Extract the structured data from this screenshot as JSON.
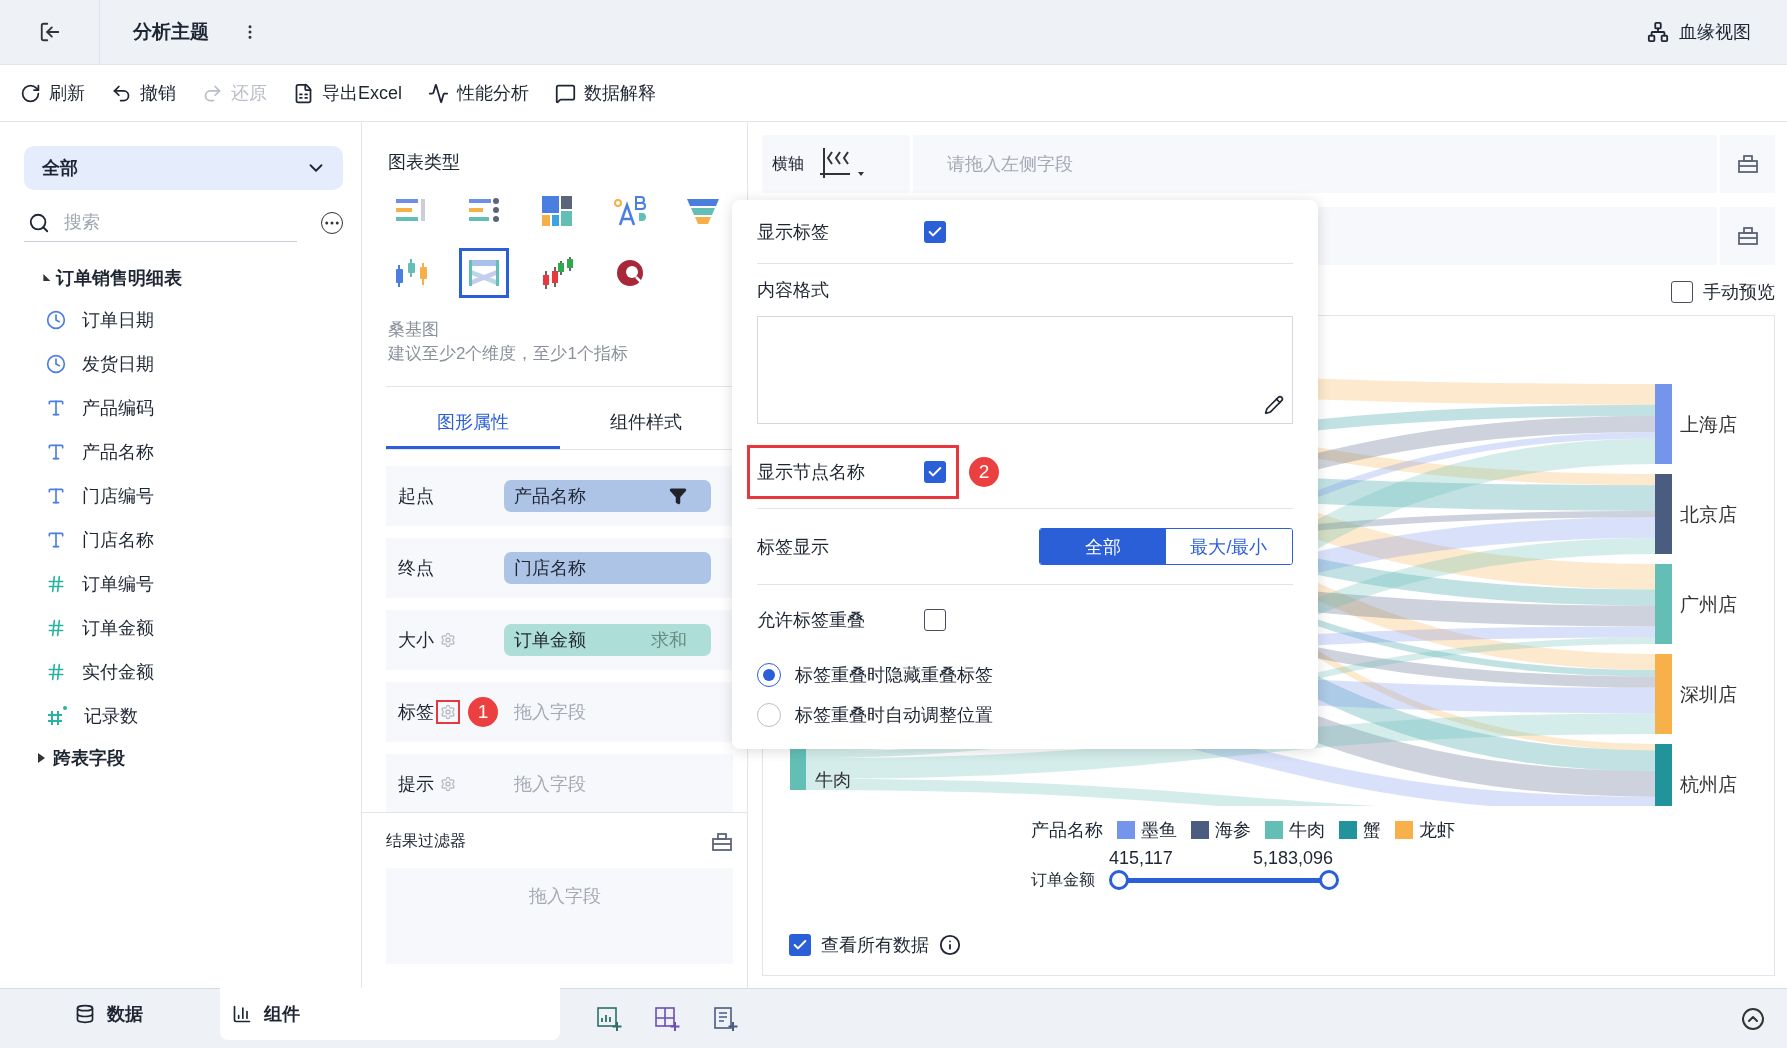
{
  "header": {
    "title": "分析主题",
    "lineage_button": "血缘视图"
  },
  "toolbar": [
    {
      "label": "刷新",
      "kind": "refresh",
      "disabled": false
    },
    {
      "label": "撤销",
      "kind": "undo",
      "disabled": false
    },
    {
      "label": "还原",
      "kind": "redo",
      "disabled": true
    },
    {
      "label": "导出Excel",
      "kind": "excel",
      "disabled": false
    },
    {
      "label": "性能分析",
      "kind": "performance",
      "disabled": false
    },
    {
      "label": "数据解释",
      "kind": "explain",
      "disabled": false
    }
  ],
  "field_panel": {
    "dataset_selector": "全部",
    "search": {
      "placeholder": "搜索"
    },
    "tree": [
      {
        "label": "订单销售明细表",
        "expanded": true,
        "children": [
          {
            "label": "订单日期",
            "kind": "date"
          },
          {
            "label": "发货日期",
            "kind": "date"
          },
          {
            "label": "产品编码",
            "kind": "text"
          },
          {
            "label": "产品名称",
            "kind": "text"
          },
          {
            "label": "门店编号",
            "kind": "text"
          },
          {
            "label": "门店名称",
            "kind": "text"
          },
          {
            "label": "订单编号",
            "kind": "number"
          },
          {
            "label": "订单金额",
            "kind": "number"
          },
          {
            "label": "实付金额",
            "kind": "number"
          },
          {
            "label": "记录数",
            "kind": "count"
          }
        ]
      },
      {
        "label": "跨表字段",
        "expanded": false
      }
    ]
  },
  "chart_types": {
    "title": "图表类型",
    "types": [
      {
        "kind": "ranked-list",
        "selected": false
      },
      {
        "kind": "dot-list",
        "selected": false
      },
      {
        "kind": "treemap",
        "selected": false
      },
      {
        "kind": "word-cloud",
        "selected": false
      },
      {
        "kind": "funnel",
        "selected": false
      },
      {
        "kind": "boxplot",
        "selected": false
      },
      {
        "kind": "sankey",
        "selected": true
      },
      {
        "kind": "candlestick",
        "selected": false
      },
      {
        "kind": "ring",
        "selected": false
      }
    ],
    "name": "桑基图",
    "hint": "建议至少2个维度，至少1个指标"
  },
  "property_tabs": [
    {
      "label": "图形属性",
      "selected": true
    },
    {
      "label": "组件样式",
      "selected": false
    }
  ],
  "slots": [
    {
      "label": "起点",
      "kind": "dimension",
      "field": "产品名称",
      "filter": true,
      "settings": false
    },
    {
      "label": "终点",
      "kind": "dimension",
      "field": "门店名称",
      "settings": false
    },
    {
      "label": "大小",
      "kind": "measure",
      "field": "订单金额",
      "aggregation": "求和",
      "settings": true
    },
    {
      "label": "标签",
      "kind": "empty",
      "hint": "拖入字段",
      "settings": true,
      "highlighted": true,
      "step": "1"
    },
    {
      "label": "提示",
      "kind": "empty",
      "hint": "拖入字段",
      "settings": true
    }
  ],
  "result_filter": {
    "title": "结果过滤器",
    "hint": "拖入字段"
  },
  "axis": {
    "label": "横轴",
    "hint": "请拖入左侧字段"
  },
  "manual_preview": {
    "label": "手动预览",
    "checked": false
  },
  "label_popup": {
    "show_label": {
      "label": "显示标签",
      "checked": true
    },
    "content_format": {
      "label": "内容格式"
    },
    "show_node_name": {
      "label": "显示节点名称",
      "checked": true,
      "highlighted": true,
      "step": "2"
    },
    "label_display": {
      "label": "标签显示",
      "options": [
        {
          "label": "全部",
          "selected": true
        },
        {
          "label": "最大/最小",
          "selected": false
        }
      ]
    },
    "allow_overlap": {
      "label": "允许标签重叠",
      "checked": false
    },
    "overlap_modes": [
      {
        "label": "标签重叠时隐藏重叠标签",
        "selected": true
      },
      {
        "label": "标签重叠时自动调整位置",
        "selected": false
      }
    ]
  },
  "chart": {
    "target_nodes": [
      {
        "label": "上海店",
        "color": "#7594ec"
      },
      {
        "label": "北京店",
        "color": "#4a5c80"
      },
      {
        "label": "广州店",
        "color": "#63bfb5"
      },
      {
        "label": "深圳店",
        "color": "#f8b04b"
      },
      {
        "label": "杭州店",
        "color": "#21939a"
      }
    ],
    "source_label": "牛肉",
    "legend": {
      "title": "产品名称",
      "items": [
        {
          "label": "墨鱼",
          "color": "#7594ec"
        },
        {
          "label": "海参",
          "color": "#4a5c80"
        },
        {
          "label": "牛肉",
          "color": "#63bfb5"
        },
        {
          "label": "蟹",
          "color": "#21939a"
        },
        {
          "label": "龙虾",
          "color": "#f8b04b"
        }
      ]
    },
    "range": {
      "title": "订单金额",
      "min": "415,117",
      "max": "5,183,096"
    }
  },
  "view_all": {
    "label": "查看所有数据",
    "checked": true
  },
  "bottom_tabs": [
    {
      "label": "数据",
      "kind": "data",
      "selected": false
    },
    {
      "label": "组件",
      "kind": "component",
      "selected": true
    }
  ]
}
